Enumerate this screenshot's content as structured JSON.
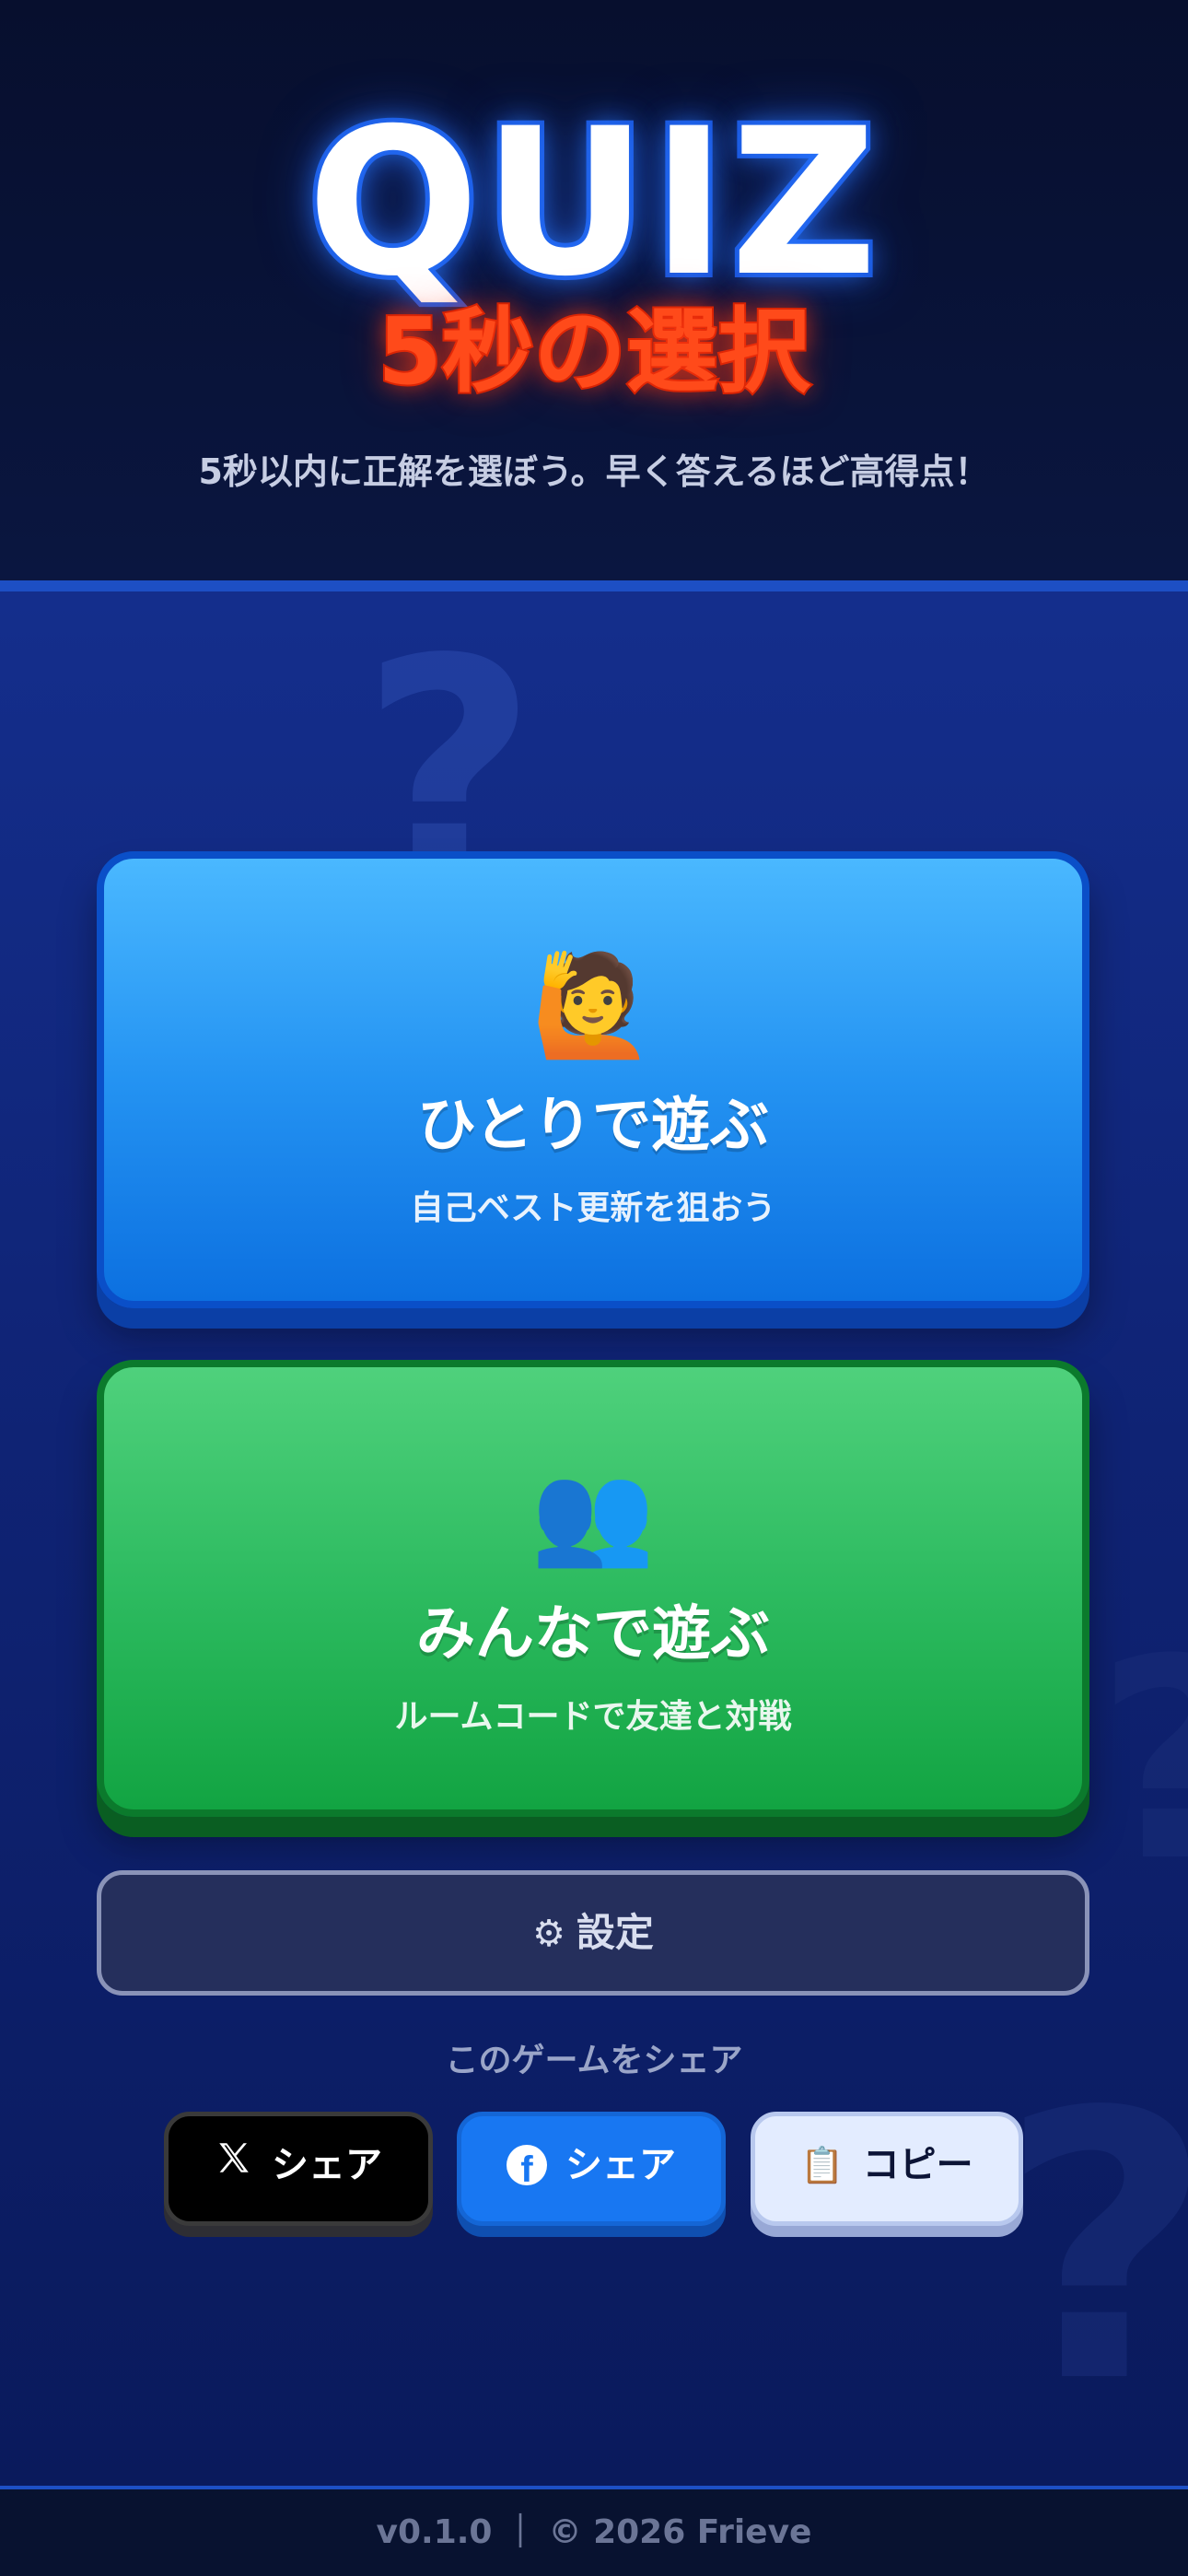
{
  "header": {
    "logo": "QUIZ",
    "subtitle": "5秒の選択",
    "tagline": "5秒以内に正解を選ぼう。早く答えるほど高得点！"
  },
  "modes": {
    "solo": {
      "emoji": "🙋",
      "title": "ひとりで遊ぶ",
      "desc": "自己ベスト更新を狙おう"
    },
    "multi": {
      "emoji": "👥",
      "title": "みんなで遊ぶ",
      "desc": "ルームコードで友達と対戦"
    }
  },
  "settings": {
    "icon": "⚙",
    "label": "設定"
  },
  "share": {
    "label": "このゲームをシェア",
    "x_label": "シェア",
    "facebook_label": "シェア",
    "copy_icon": "📋",
    "copy_label": "コピー"
  },
  "decor": {
    "glyph": "?"
  },
  "footer": {
    "text": "v0.1.0 ｜ © 2026 Frieve"
  },
  "colors": {
    "solo_card": "#2493f2",
    "multi_card": "#2dbb60",
    "facebook": "#1877f2",
    "logo_accent": "#ff4a1a"
  }
}
